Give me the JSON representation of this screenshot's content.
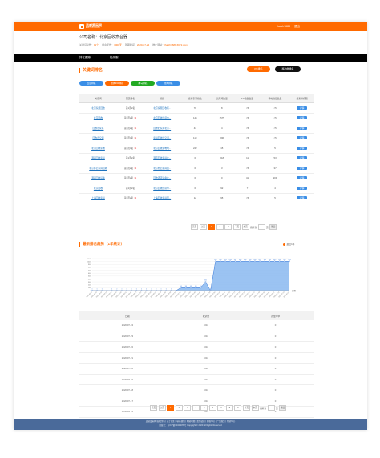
{
  "header": {
    "logo_line1": "灵感爱采网",
    "logo_line2": "ZOTLX.COM",
    "user": "lhaizh1688",
    "logout": "退出"
  },
  "company": {
    "label": "公司名称：",
    "name": "北京回收案台器",
    "meta": [
      {
        "label": "关键词总数：",
        "value": "11个"
      },
      {
        "label": "剩余天数：",
        "value": "1000天"
      },
      {
        "label": "到期时间：",
        "value": "2020-07-24"
      },
      {
        "label": "推广网站：",
        "value": "lhaizh1688.6672.com"
      }
    ]
  },
  "nav": [
    "排名跟踪",
    "检测服"
  ],
  "keywords_panel": {
    "title": "关键词排名",
    "btn_pc": "PC排名",
    "btn_mobile": "移动端排名",
    "pills": [
      {
        "label": "百度排名",
        "color": "#3a8ee6"
      },
      {
        "label": "搜狗360排名",
        "color": "#ff6a00"
      },
      {
        "label": "神马排名",
        "color": "#22aa22"
      },
      {
        "label": "搜狗排名",
        "color": "#3a8ee6"
      }
    ],
    "columns": [
      "关键词",
      "首页排名",
      "标题",
      "搜索引擎指数",
      "长尾词数量",
      "PC指数数量",
      "移动指数数量",
      "搜索排名图"
    ],
    "rows": [
      {
        "kw": "北京家居回收",
        "rank": "第1页2名",
        "trend": "",
        "title": "北京家居回收有...",
        "idx": "70",
        "lt": "8",
        "pc": "<5",
        "mb": "<5",
        "op": "详情"
      },
      {
        "kw": "北京回收",
        "rank": "第1页2名",
        "trend": "↑2",
        "title": "北京回收旧货市...",
        "idx": "145",
        "lt": "1575",
        "pc": "<5",
        "mb": "<5",
        "op": "详情"
      },
      {
        "kw": "回收旧家具",
        "rank": "第1页2名",
        "trend": "↑1",
        "title": "回收旧家具北京...",
        "idx": "44",
        "lt": "4",
        "pc": "<5",
        "mb": "<5",
        "op": "详情"
      },
      {
        "kw": "回收旧空调",
        "rank": "第1页3名",
        "trend": "↑1",
        "title": "家具回收旧空调...",
        "idx": "119",
        "lt": "296",
        "pc": "<5",
        "mb": "<5",
        "op": "详情"
      },
      {
        "kw": "北京回收家电",
        "rank": "第1页3名",
        "trend": "↑1",
        "title": "北京回收家电电...",
        "idx": "242",
        "lt": "15",
        "pc": "<5",
        "mb": "5",
        "op": "详情"
      },
      {
        "kw": "酒店回收家具",
        "rank": "第1页2名",
        "trend": "",
        "title": "酒店回收家具北...",
        "idx": "0",
        "lt": "218",
        "pc": "11",
        "mb": "53",
        "op": "详情"
      },
      {
        "kw": "北京办公家具回收",
        "rank": "第1页2名",
        "trend": "↑2",
        "title": "北京办公家具回...",
        "idx": "0",
        "lt": "3",
        "pc": "<5",
        "mb": "37",
        "op": "详情"
      },
      {
        "kw": "酒店回收设备",
        "rank": "第1页2名",
        "trend": "↑1",
        "title": "回收酒店设备北...",
        "idx": "0",
        "lt": "0",
        "pc": "41",
        "mb": "209",
        "op": "详情"
      },
      {
        "kw": "北京回收",
        "rank": "第1页2名",
        "trend": "",
        "title": "北京回收旧货市...",
        "idx": "0",
        "lt": "92",
        "pc": "7",
        "mb": "4",
        "op": "详情"
      },
      {
        "kw": "上海回收家具",
        "rank": "第1页2名",
        "trend": "↑2",
        "title": "上海回收家具回...",
        "idx": "12",
        "lt": "95",
        "pc": "<5",
        "mb": "5",
        "op": "详情"
      }
    ],
    "pager": {
      "first": "首页",
      "prev": "上页",
      "pages": [
        "1",
        "2",
        "3"
      ],
      "next": "下页",
      "last": "末页",
      "jump": "跳转到",
      "page_unit": "页",
      "go": "确定"
    }
  },
  "trend_panel": {
    "title": "最新排名趋势（1年统计）",
    "filter": "最近1年",
    "axis_label": "日期"
  },
  "chart_data": {
    "type": "area",
    "x": [
      "2020-06-14",
      "2020-06-15",
      "2020-06-16",
      "2020-06-17",
      "2020-06-18",
      "2020-06-19",
      "2020-06-20",
      "2020-06-21",
      "2020-06-22",
      "2020-06-23",
      "2020-06-24",
      "2020-06-25",
      "2020-06-26",
      "2020-06-27",
      "2020-06-28",
      "2020-06-29",
      "2020-06-30",
      "2020-07-01",
      "2020-07-02",
      "2020-07-03",
      "2020-07-04",
      "2020-07-05",
      "2020-07-06",
      "2020-07-07",
      "2020-07-08",
      "2020-07-09",
      "2020-07-10",
      "2020-07-11",
      "2020-07-12",
      "2020-07-13",
      "2020-07-14",
      "2020-07-15",
      "2020-07-16",
      "2020-07-17",
      "2020-07-18",
      "2020-07-19",
      "2020-07-20",
      "2020-07-21",
      "2020-07-22",
      "2020-07-23",
      "2020-07-24"
    ],
    "series": [
      {
        "values": [
          0,
          0,
          0,
          0,
          0,
          0,
          0,
          0,
          0,
          0,
          0,
          0,
          0,
          0,
          0,
          0,
          0,
          0,
          103,
          103,
          103,
          103,
          103,
          300,
          0,
          1010,
          1010,
          1010,
          1010,
          1010,
          1010,
          1010,
          1010,
          1010,
          1010,
          1010,
          1010,
          1010,
          1010,
          1010,
          1010
        ]
      }
    ],
    "yticks": [
      0,
      100,
      200,
      300,
      400,
      500,
      600,
      700,
      800,
      900,
      1000,
      1100
    ],
    "ylim": [
      0,
      1100
    ],
    "xlabel": "日期"
  },
  "daily_table": {
    "columns": [
      "日期",
      "收录量",
      "首位命中"
    ],
    "rows": [
      {
        "date": "2020-07-24",
        "count": "1010",
        "first": "0"
      },
      {
        "date": "2020-07-23",
        "count": "1010",
        "first": "0"
      },
      {
        "date": "2020-07-22",
        "count": "1010",
        "first": "0"
      },
      {
        "date": "2020-07-21",
        "count": "1010",
        "first": "0"
      },
      {
        "date": "2020-07-20",
        "count": "1010",
        "first": "0"
      },
      {
        "date": "2020-07-19",
        "count": "1010",
        "first": "0"
      },
      {
        "date": "2020-07-18",
        "count": "1010",
        "first": "0"
      },
      {
        "date": "2020-07-17",
        "count": "1010",
        "first": "0"
      },
      {
        "date": "2020-07-16",
        "count": "1010",
        "first": "0"
      },
      {
        "date": "2020-07-15",
        "count": "1010",
        "first": "0"
      }
    ],
    "pager": {
      "first": "首页",
      "prev": "上页",
      "pages": [
        "1",
        "2",
        "3",
        "4",
        "5",
        "6",
        "7",
        "8",
        "9"
      ],
      "next": "下页",
      "last": "末页",
      "jump": "跳转到",
      "page_unit": "页",
      "go": "确定"
    }
  },
  "footer": {
    "line1": "灵感爱采网 版权所有 | 关于我们 | 联系我们 | 网站地图 | 友情链接 | 客服中心 | 广告服务 | 帮助中心",
    "line2": "备案号：京ICP备12345678号 Copyright © 2020 All Rights Reserved"
  }
}
